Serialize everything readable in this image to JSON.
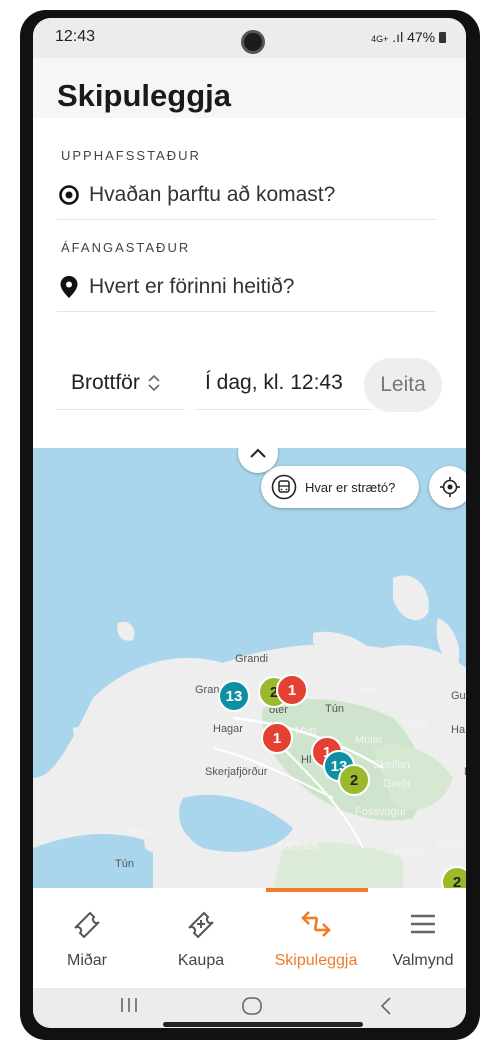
{
  "status_bar": {
    "time": "12:43",
    "network": "4G+",
    "battery": "47%"
  },
  "header": {
    "title": "Skipuleggja"
  },
  "origin": {
    "label": "UPPHAFSSTAÐUR",
    "placeholder": "Hvaðan þarftu að komast?",
    "icon": "target-icon"
  },
  "destination": {
    "label": "ÁFANGASTAÐUR",
    "placeholder": "Hvert er förinni heitið?",
    "icon": "location-pin-icon"
  },
  "options": {
    "time_mode": "Brottför",
    "date_time": "Í dag, kl. 12:43",
    "search_label": "Leita"
  },
  "map": {
    "bus_button_label": "Hvar er strætó?",
    "places": [
      "Grandi",
      "Gran",
      "Hagar",
      "Tún",
      "Lækir",
      "Sund",
      "Múlar",
      "Skeifan",
      "Gerði",
      "Fossvogur",
      "Skerjafjörður",
      "Stigar",
      "Kársnes",
      "Hjallar",
      "Stekkir",
      "Gu",
      "Ha",
      "Tún",
      "Mýri",
      "Hl",
      "Mi",
      "ðter"
    ],
    "markers": [
      {
        "color": "teal",
        "count": "13"
      },
      {
        "color": "green",
        "count": "2"
      },
      {
        "color": "red",
        "count": "1"
      },
      {
        "color": "red",
        "count": "1"
      },
      {
        "color": "red",
        "count": "1"
      },
      {
        "color": "teal",
        "count": "13"
      },
      {
        "color": "green",
        "count": "2"
      },
      {
        "color": "green",
        "count": "2"
      }
    ]
  },
  "tabs": [
    {
      "label": "Miðar",
      "icon": "ticket-icon"
    },
    {
      "label": "Kaupa",
      "icon": "ticket-add-icon"
    },
    {
      "label": "Skipuleggja",
      "icon": "route-arrows-icon",
      "active": true
    },
    {
      "label": "Valmynd",
      "icon": "menu-icon"
    }
  ],
  "colors": {
    "accent": "#f07c2a",
    "water": "#a9d6ec",
    "land": "#eeeeee",
    "park": "#cfe4cc",
    "marker_teal": "#0f8fa3",
    "marker_red": "#e44133",
    "marker_green": "#9ab92d"
  }
}
